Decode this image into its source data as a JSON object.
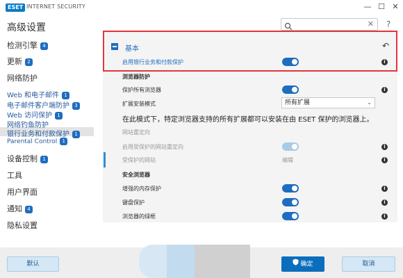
{
  "titlebar": {
    "logo": "ESET",
    "app_name": "INTERNET SECURITY",
    "minimize": "—",
    "maximize": "☐",
    "close": "✕"
  },
  "header": {
    "page_title": "高级设置",
    "search_value": "",
    "search_clear": "✕",
    "help": "?"
  },
  "sidebar": {
    "items": [
      {
        "label": "检测引擎",
        "badge": "4"
      },
      {
        "label": "更新",
        "badge": "2"
      },
      {
        "label": "网络防护",
        "badge": ""
      },
      {
        "label": "Web 和电子邮件",
        "badge": "1"
      },
      {
        "label": "电子邮件客户端防护",
        "badge": "3"
      },
      {
        "label": "Web 访问保护",
        "badge": "1"
      },
      {
        "label": "网络钓鱼防护",
        "badge": ""
      },
      {
        "label": "银行业务和付款保护",
        "badge": "1"
      },
      {
        "label": "Parental Control",
        "badge": "1"
      },
      {
        "label": "设备控制",
        "badge": "1"
      },
      {
        "label": "工具",
        "badge": ""
      },
      {
        "label": "用户界面",
        "badge": ""
      },
      {
        "label": "通知",
        "badge": "4"
      },
      {
        "label": "隐私设置",
        "badge": ""
      }
    ]
  },
  "section": {
    "title": "基本",
    "undo": "↶",
    "enable_label": "启用银行业务和付款保护",
    "browser_protection_head": "浏览器防护",
    "protect_all_label": "保护所有浏览器",
    "ext_mode_label": "扩展安装模式",
    "ext_mode_value": "所有扩展",
    "note": "在此模式下，特定浏览器支持的所有扩展都可以安装在由 ESET 保护的浏览器上。",
    "redirect_head": "网站重定向",
    "redirect_enable_label": "启用受保护的网站重定向",
    "protected_sites_label": "受保护的网站",
    "edit_link": "编辑",
    "secure_browser_head": "安全浏览器",
    "memory_label": "增强的内存保护",
    "keyboard_label": "键盘保护",
    "border_label": "浏览器的绿框",
    "info": "i",
    "select_arrow": "⌄"
  },
  "footer": {
    "default": "默认",
    "ok": "确定",
    "cancel": "取消"
  },
  "colors": {
    "accent": "#1e6dc0",
    "highlight_border": "#e0363c",
    "logo": "#0a7cc4",
    "primary_button": "#0a6ebd"
  }
}
